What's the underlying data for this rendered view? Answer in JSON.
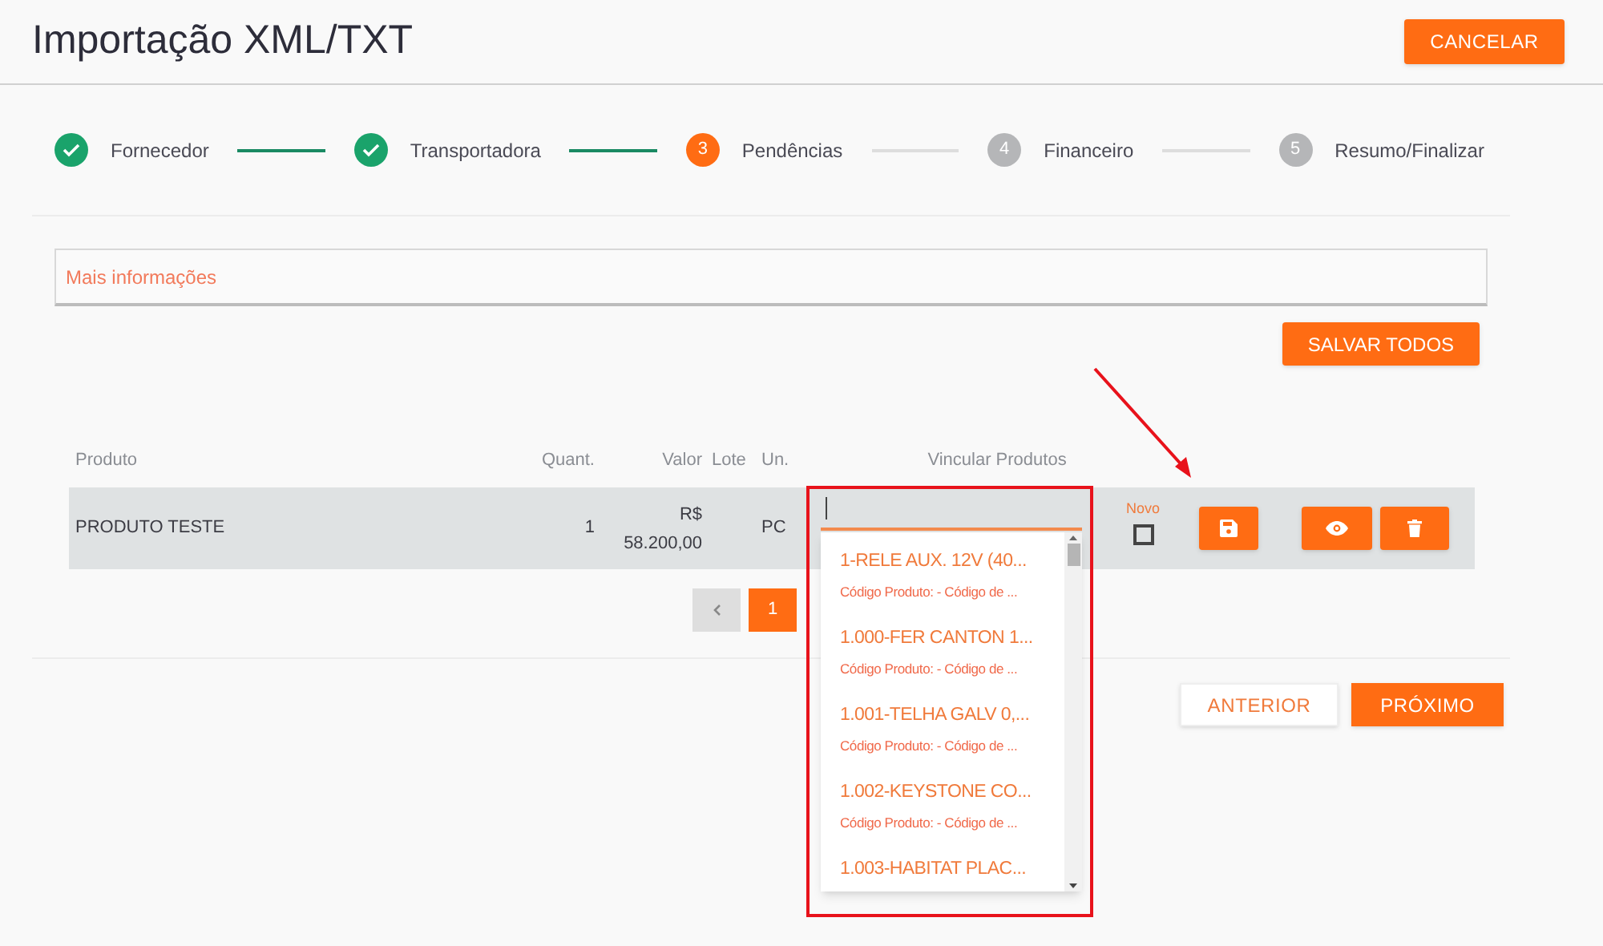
{
  "header": {
    "title": "Importação XML/TXT",
    "cancel_button": "CANCELAR"
  },
  "steps": [
    {
      "label": "Fornecedor",
      "completed": true,
      "selected": false
    },
    {
      "label": "Transportadora",
      "completed": true,
      "selected": false
    },
    {
      "number": "3",
      "label": "Pendências",
      "completed": false,
      "selected": true
    },
    {
      "number": "4",
      "label": "Financeiro",
      "completed": false,
      "selected": false
    },
    {
      "number": "5",
      "label": "Resumo/Finalizar",
      "completed": false,
      "selected": false
    }
  ],
  "info_field": {
    "placeholder": "Mais informações"
  },
  "save_all_button": "SALVAR TODOS",
  "table": {
    "columns": [
      "Produto",
      "Quant.",
      "Valor",
      "Lote",
      "Un.",
      "Vincular Produtos"
    ],
    "rows": [
      {
        "produto": "PRODUTO TESTE",
        "quant": "1",
        "valor": "R$ 58.200,00",
        "un": "PC",
        "novo_label": "Novo",
        "novo_checked": false
      }
    ]
  },
  "pagination": {
    "pages": [
      {
        "label": "1",
        "selected": true
      }
    ]
  },
  "nav": {
    "previous": "ANTERIOR",
    "next": "PRÓXIMO"
  },
  "dropdown": {
    "options": [
      {
        "title": "1-RELE AUX. 12V (40...",
        "detail": "Código Produto: - Código de ..."
      },
      {
        "title": "1.000-FER CANTON 1...",
        "detail": "Código Produto: - Código de ..."
      },
      {
        "title": "1.001-TELHA GALV 0,...",
        "detail": "Código Produto: - Código de ..."
      },
      {
        "title": "1.002-KEYSTONE CO...",
        "detail": "Código Produto: - Código de ..."
      },
      {
        "title": "1.003-HABITAT PLAC..."
      }
    ]
  }
}
